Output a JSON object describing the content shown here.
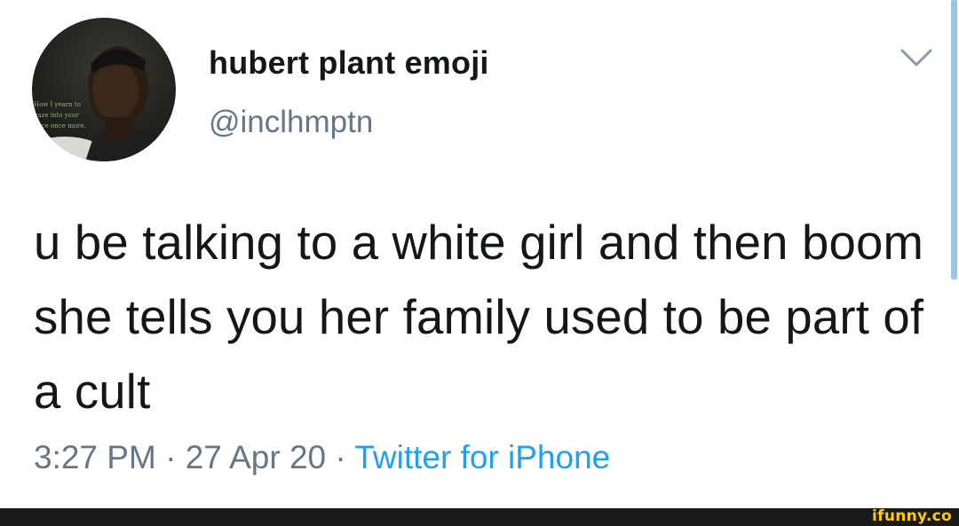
{
  "tweet": {
    "display_name": "hubert plant emoji",
    "handle": "@inclhmptn",
    "text": "u be talking to a white girl and then boom she tells you her family used to be part of a cult",
    "time": "3:27 PM",
    "separator": " · ",
    "date": "27 Apr 20",
    "source": "Twitter for iPhone",
    "avatar_overlay_text": [
      "How I yearn to",
      "gaze into your",
      "face once more."
    ],
    "icons": {
      "menu": "chevron-down-icon"
    },
    "colors": {
      "name": "#14171a",
      "secondary": "#657786",
      "link": "#1da1f2",
      "scrollbar": "#8ec7f1"
    }
  },
  "watermark": {
    "text": "ifunny.co",
    "color": "#ffcc00",
    "bar_color": "#1b1a1a"
  }
}
